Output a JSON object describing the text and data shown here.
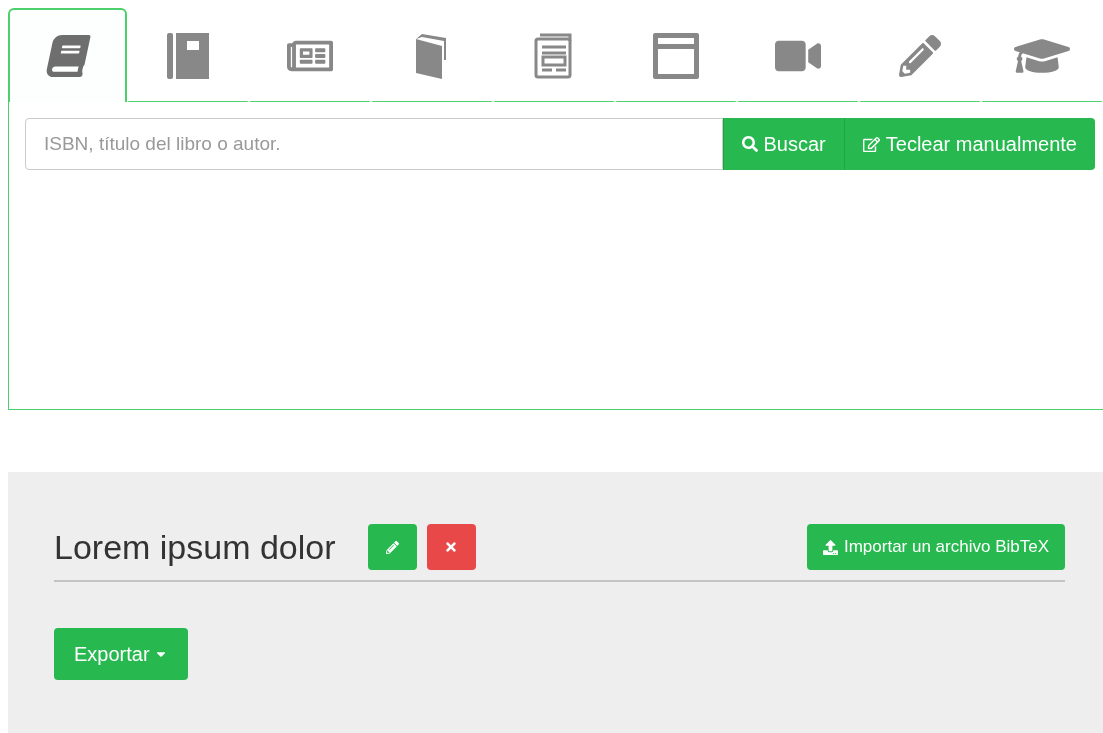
{
  "tabs": [
    {
      "selected": true
    },
    {
      "selected": false
    },
    {
      "selected": false
    },
    {
      "selected": false
    },
    {
      "selected": false
    },
    {
      "selected": false
    },
    {
      "selected": false
    },
    {
      "selected": false
    },
    {
      "selected": false
    }
  ],
  "search": {
    "placeholder": "ISBN, título del libro o autor.",
    "search_button": "Buscar",
    "manual_button": "Teclear manualmente"
  },
  "project": {
    "title": "Lorem ipsum dolor",
    "import_button": "Importar un archivo BibTeX",
    "export_button": "Exportar"
  }
}
